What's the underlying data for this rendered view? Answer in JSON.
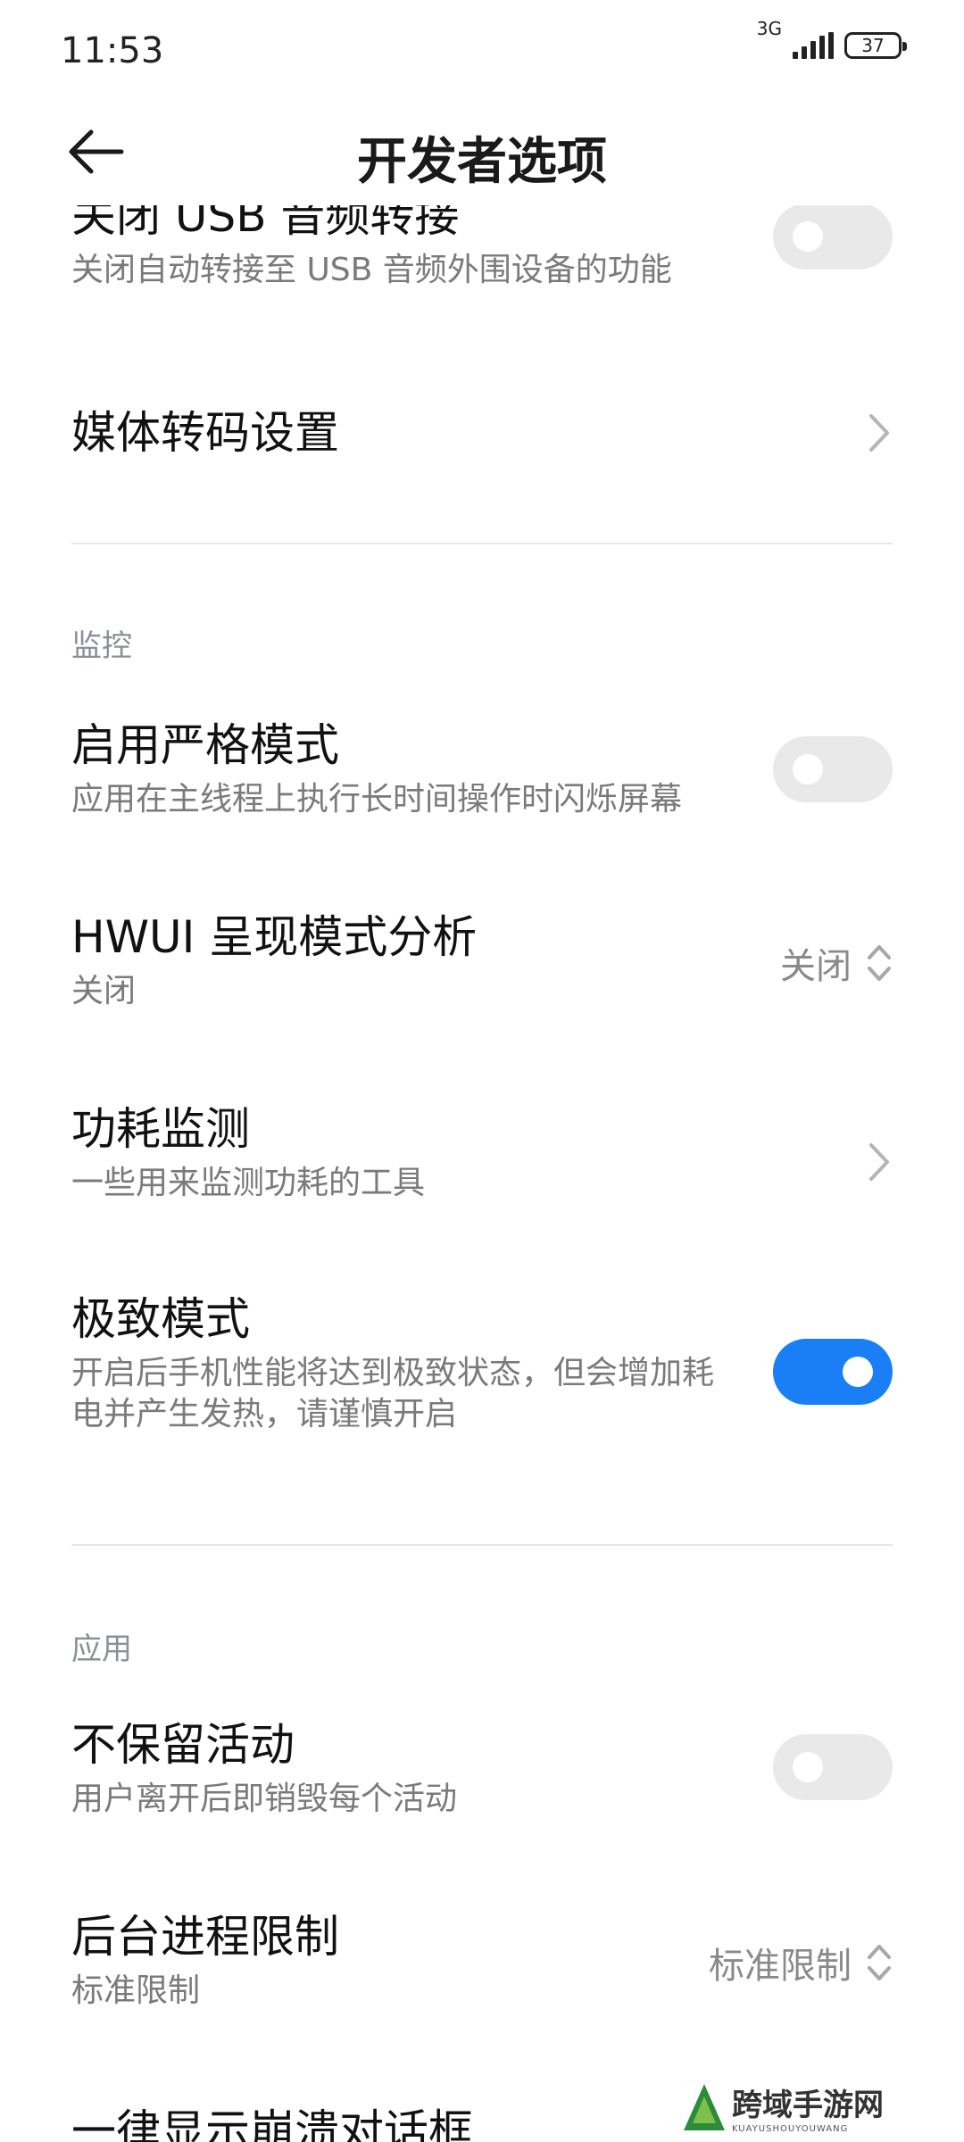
{
  "status_bar": {
    "time": "11:53",
    "network": "3G",
    "battery": "37"
  },
  "header": {
    "title": "开发者选项"
  },
  "items": {
    "usb_audio": {
      "title": "关闭 USB 音频转接",
      "subtitle": "关闭自动转接至 USB 音频外围设备的功能",
      "enabled": false
    },
    "media_transcode": {
      "title": "媒体转码设置"
    },
    "strict_mode": {
      "title": "启用严格模式",
      "subtitle": "应用在主线程上执行长时间操作时闪烁屏幕",
      "enabled": false
    },
    "hwui": {
      "title": "HWUI 呈现模式分析",
      "subtitle": "关闭",
      "value": "关闭"
    },
    "power_monitor": {
      "title": "功耗监测",
      "subtitle": "一些用来监测功耗的工具"
    },
    "extreme_mode": {
      "title": "极致模式",
      "subtitle_line1": "开启后手机性能将达到极致状态，但会增加耗",
      "subtitle_line2": "电并产生发热，请谨慎开启",
      "enabled": true
    },
    "dont_keep_activities": {
      "title": "不保留活动",
      "subtitle": "用户离开后即销毁每个活动",
      "enabled": false
    },
    "bg_process_limit": {
      "title": "后台进程限制",
      "subtitle": "标准限制",
      "value": "标准限制"
    },
    "show_crash_dialog": {
      "title": "一律显示崩溃对话框"
    }
  },
  "sections": {
    "monitoring": "监控",
    "apps": "应用"
  },
  "watermark": {
    "text": "跨域手游网",
    "sub": "KUAYUSHOUYOUWANG"
  },
  "colors": {
    "accent": "#1a7ff6",
    "toggle_off": "#e9e9e9",
    "section": "#8a8f99"
  }
}
